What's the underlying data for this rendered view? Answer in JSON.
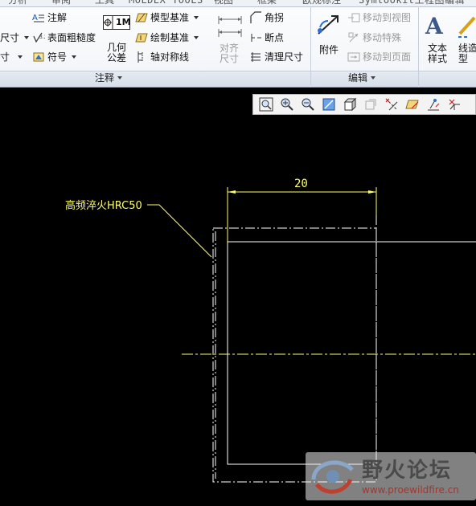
{
  "ribbon": {
    "tabs": [
      "分析",
      "审阅",
      "工具",
      "MOLDEX TOOLS",
      "视图",
      "框架",
      "欧规标注",
      "Symtookit工程图编辑"
    ],
    "annotate": {
      "dim_partial": "尺寸",
      "dim_partial2": "寸",
      "note": "注解",
      "surface_finish": "表面粗糙度",
      "symbol": "符号",
      "geom_tol_label": "几何\n公差",
      "geom_tol_icon_text": "1M",
      "model_datum": "模型基准",
      "draw_datum": "绘制基准",
      "axis_symmetry": "轴对称线",
      "align_dim": "对齐\n尺寸",
      "chamfer": "角拐",
      "break_point": "断点",
      "cleanup_dim": "清理尺寸",
      "group_label": "注释"
    },
    "edit": {
      "attachment": "附件",
      "move_to_view": "移动到视图",
      "move_special": "移动特殊",
      "move_to_page": "移动到页面",
      "group_label": "编辑"
    },
    "format": {
      "text_style": "文本\n样式",
      "line_style": "线造\n型"
    }
  },
  "view_toolbar": {
    "buttons": [
      "refit-icon",
      "zoom-in-icon",
      "zoom-out-icon",
      "repaint-icon",
      "display-style-icon",
      "saved-views-icon",
      "datum-axis-display-icon",
      "datum-plane-display-icon",
      "datum-point-display-icon",
      "csys-display-icon"
    ]
  },
  "drawing": {
    "note_text": "高频淬火HRC50",
    "dimension_value": "20",
    "colors": {
      "background": "#000000",
      "geometry": "#ffffff",
      "annotation": "#ffff66"
    }
  },
  "watermark": {
    "title": "野火论坛",
    "url": "www.proewildfire.cn"
  }
}
